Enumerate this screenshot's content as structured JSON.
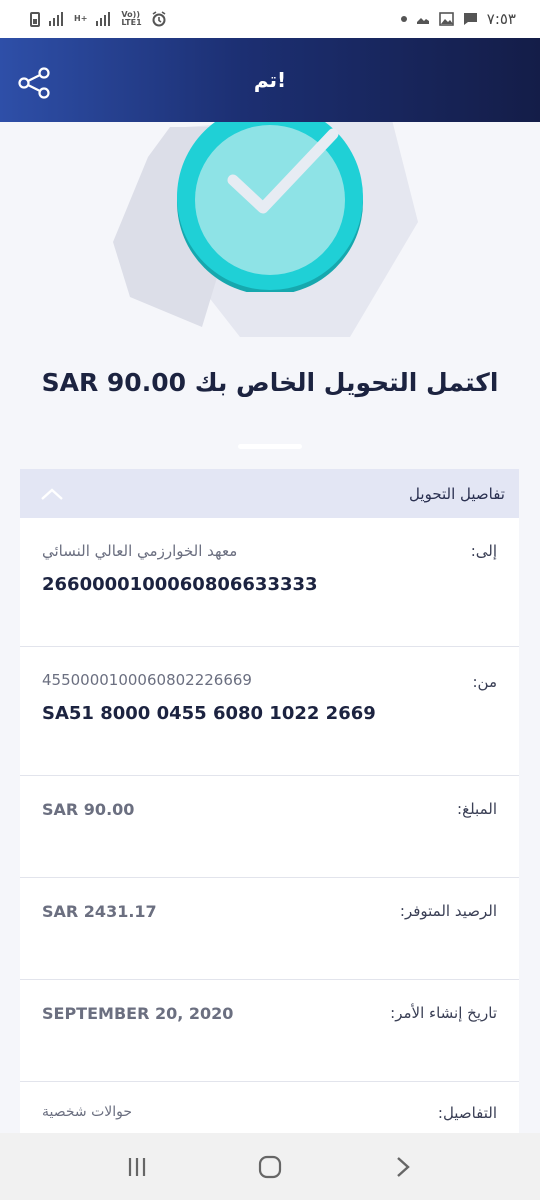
{
  "status_bar": {
    "time": "٧:٥٣",
    "network_label": "LTE1",
    "volte_label": "Vo))",
    "hplus_label": "H+"
  },
  "header": {
    "title": "تم!"
  },
  "done_message": "اكتمل التحويل الخاص بك SAR 90.00",
  "details": {
    "section_title": "تفاصيل التحويل",
    "to": {
      "label": "إلى:",
      "name": "معهد الخوارزمي العالي النسائي",
      "account": "2660000100060806633333"
    },
    "from": {
      "label": "من:",
      "account_number": "4550000100060802226669",
      "iban": "SA51 8000 0455 6080 1022 2669"
    },
    "amount": {
      "label": "المبلغ:",
      "value": "SAR 90.00"
    },
    "available_balance": {
      "label": "الرصيد المتوفر:",
      "value": "SAR 2431.17"
    },
    "order_date": {
      "label": "تاريخ إنشاء الأمر:",
      "value": "SEPTEMBER 20, 2020"
    },
    "notes": {
      "label": "التفاصيل:",
      "value": "حوالات شخصية"
    }
  },
  "icons": {
    "share": "share-icon",
    "check": "check-circle-icon",
    "collapse": "chevron-up-icon",
    "nav_recents": "recents-icon",
    "nav_home": "home-icon",
    "nav_back": "back-icon"
  },
  "colors": {
    "header_gradient_start": "#2e4fa8",
    "header_gradient_end": "#141d48",
    "check_teal": "#1fd0d6",
    "panel_header": "#e3e6f4"
  }
}
